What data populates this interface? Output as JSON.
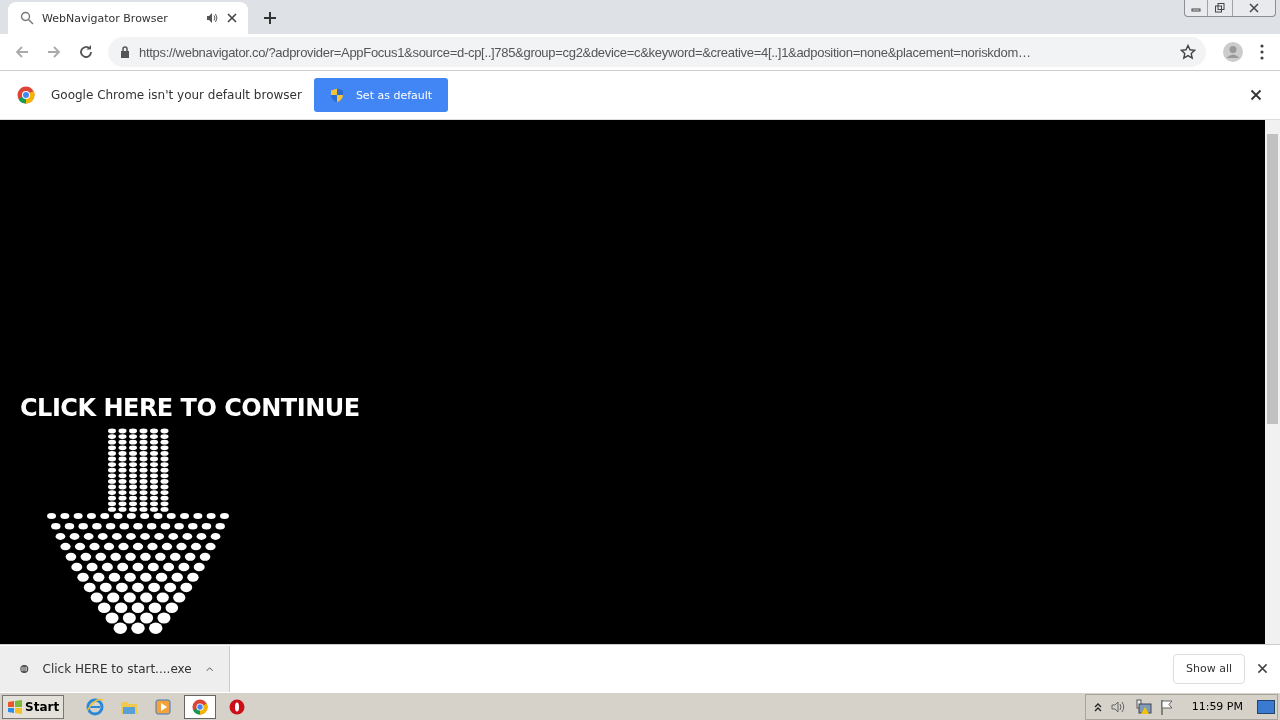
{
  "window": {
    "controls": [
      {
        "kind": "minimize"
      },
      {
        "kind": "restore"
      },
      {
        "kind": "close"
      }
    ]
  },
  "tabs": [
    {
      "title": "WebNavigator Browser",
      "selected": true,
      "audio": true
    }
  ],
  "address_bar": {
    "url": "https://webnavigator.co/?adprovider=AppFocus1&source=d-cp[..]785&group=cg2&device=c&keyword=&creative=4[..]1&adposition=none&placement=noriskdom…"
  },
  "infobar": {
    "message": "Google Chrome isn't your default browser",
    "button": "Set as default"
  },
  "page": {
    "headline": "CLICK HERE TO CONTINUE"
  },
  "download_bar": {
    "file": "Click HERE to start....exe",
    "show_all": "Show all"
  },
  "taskbar": {
    "start": "Start",
    "apps": [
      {
        "kind": "ie",
        "selected": false
      },
      {
        "kind": "explorer",
        "selected": false
      },
      {
        "kind": "media",
        "selected": false
      },
      {
        "kind": "chrome",
        "selected": true
      },
      {
        "kind": "opera",
        "selected": false
      }
    ],
    "clock": "11:59 PM"
  }
}
